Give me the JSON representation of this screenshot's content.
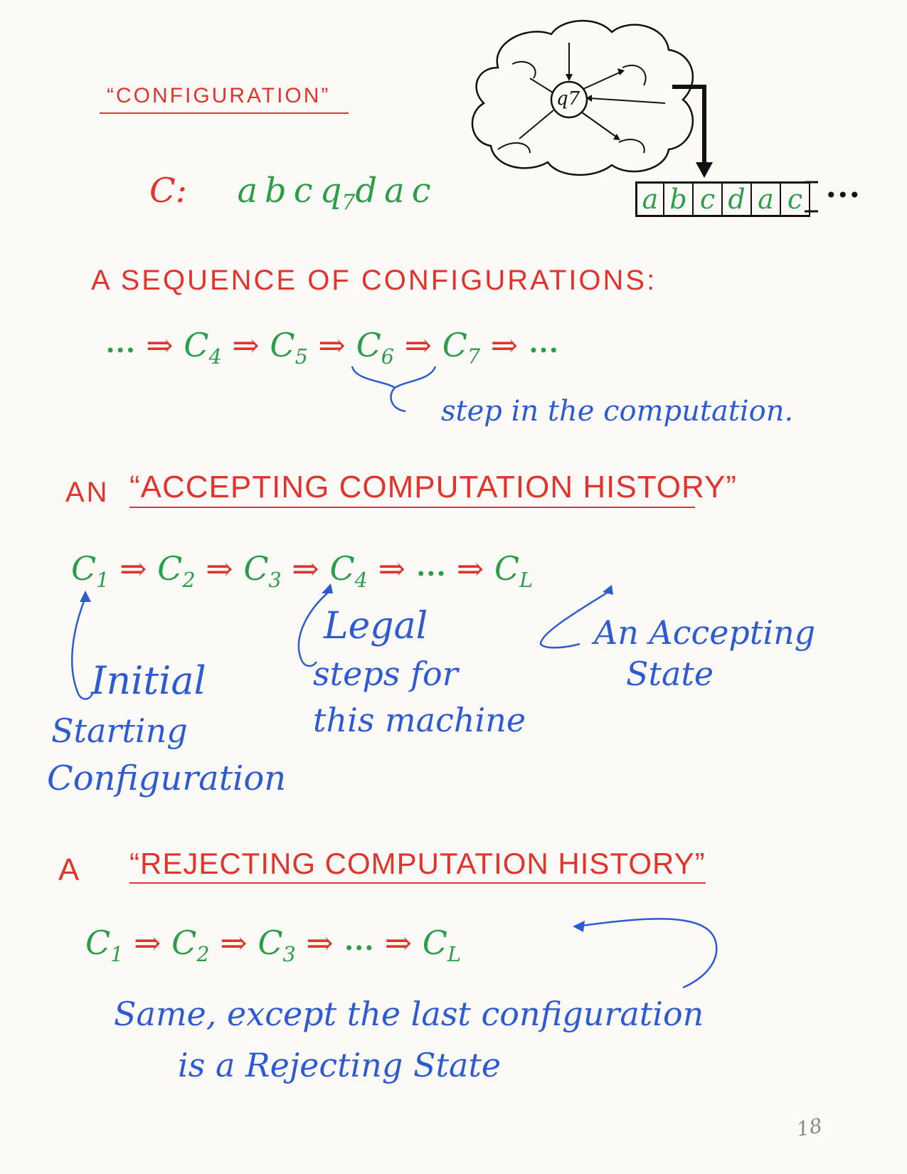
{
  "config_heading": "“CONFIGURATION”",
  "config_example": {
    "label": "C:",
    "before": "abc",
    "state": "q",
    "state_sub": "7",
    "after": "dac"
  },
  "machine": {
    "state_label": "q7",
    "tape_cells": [
      "a",
      "b",
      "c",
      "d",
      "a",
      "c"
    ],
    "tape_ellipsis": "•••"
  },
  "sequence_heading": "A SEQUENCE OF CONFIGURATIONS:",
  "sequence": {
    "lead": "•••",
    "arrow": "⇒",
    "items": [
      {
        "c": "C",
        "sub": "4"
      },
      {
        "c": "C",
        "sub": "5"
      },
      {
        "c": "C",
        "sub": "6"
      },
      {
        "c": "C",
        "sub": "7"
      }
    ],
    "trail": "•••",
    "step_note": "step in the computation."
  },
  "accepting": {
    "prefix": "AN",
    "title": "“ACCEPTING COMPUTATION HISTORY”",
    "chain": {
      "c1": "C",
      "c1_sub": "1",
      "c2": "C",
      "c2_sub": "2",
      "c3": "C",
      "c3_sub": "3",
      "c4": "C",
      "c4_sub": "4",
      "dots": "•••",
      "cl": "C",
      "cl_sub": "L",
      "arrow": "⇒"
    },
    "note_initial": [
      "Initial",
      "Starting",
      "Configuration"
    ],
    "note_legal": [
      "Legal",
      "steps for",
      "this machine"
    ],
    "note_accept": [
      "An Accepting",
      "State"
    ]
  },
  "rejecting": {
    "prefix": "A",
    "title": "“REJECTING COMPUTATION HISTORY”",
    "chain": {
      "c1": "C",
      "c1_sub": "1",
      "c2": "C",
      "c2_sub": "2",
      "c3": "C",
      "c3_sub": "3",
      "dots": "•••",
      "cl": "C",
      "cl_sub": "L",
      "arrow": "⇒"
    },
    "note": [
      "Same, except the last configuration",
      "is a Rejecting State"
    ]
  },
  "page_number": "18"
}
